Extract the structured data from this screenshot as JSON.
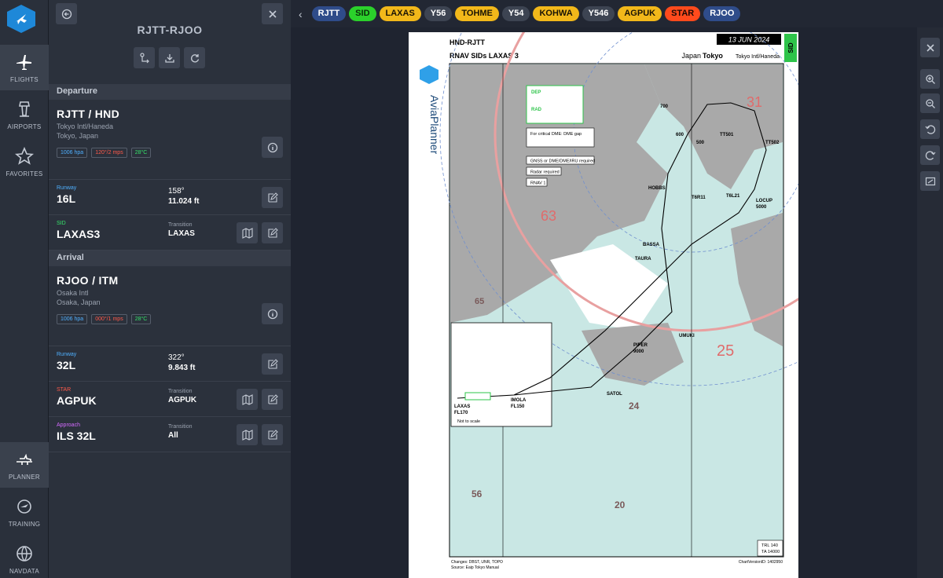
{
  "nav": {
    "items": [
      {
        "label": "FLIGHTS"
      },
      {
        "label": "AIRPORTS"
      },
      {
        "label": "FAVORITES"
      },
      {
        "label": "PLANNER"
      },
      {
        "label": "TRAINING"
      },
      {
        "label": "NAVDATA"
      }
    ]
  },
  "panel": {
    "route": "RJTT-RJOO",
    "departure_label": "Departure",
    "arrival_label": "Arrival",
    "departure": {
      "code": "RJTT / HND",
      "name": "Tokyo Intl/Haneda",
      "city": "Tokyo, Japan",
      "qnh": "1006 hpa",
      "wind": "120°/2 mps",
      "temp": "28°C",
      "runway_label": "Runway",
      "runway": "16L",
      "heading": "158°",
      "length": "11.024 ft",
      "sid_label": "SID",
      "sid": "LAXAS3",
      "transition_label": "Transition",
      "transition": "LAXAS"
    },
    "arrival": {
      "code": "RJOO / ITM",
      "name": "Osaka Intl",
      "city": "Osaka, Japan",
      "qnh": "1006 hpa",
      "wind": "000°/1 mps",
      "temp": "28°C",
      "runway_label": "Runway",
      "runway": "32L",
      "heading": "322°",
      "length": "9.843 ft",
      "star_label": "STAR",
      "star": "AGPUK",
      "star_transition_label": "Transition",
      "star_transition": "AGPUK",
      "approach_label": "Approach",
      "approach": "ILS 32L",
      "approach_transition_label": "Transition",
      "approach_transition": "All"
    }
  },
  "tabs": [
    {
      "label": "RJTT",
      "kind": "airport"
    },
    {
      "label": "SID",
      "kind": "sid"
    },
    {
      "label": "LAXAS",
      "kind": "wpt"
    },
    {
      "label": "Y56",
      "kind": "awy"
    },
    {
      "label": "TOHME",
      "kind": "wpt"
    },
    {
      "label": "Y54",
      "kind": "awy"
    },
    {
      "label": "KOHWA",
      "kind": "wpt"
    },
    {
      "label": "Y546",
      "kind": "awy"
    },
    {
      "label": "AGPUK",
      "kind": "wpt"
    },
    {
      "label": "STAR",
      "kind": "star"
    },
    {
      "label": "RJOO",
      "kind": "airport"
    }
  ],
  "chart": {
    "id": "HND-RJTT",
    "title": "RNAV SIDs LAXAS 3",
    "date": "13 JUN 2024",
    "country": "Japan",
    "city": "Tokyo",
    "airport": "Tokyo Intl/Haneda",
    "tag": "SID",
    "brand": "AviaPlanner",
    "freq_dep_label": "DEP",
    "freq_rad_label": "RAD",
    "notes": [
      "For critical DME: DME gap",
      "GNSS or DME/DME/IRU required",
      "Radar required",
      "RNAV 1"
    ],
    "not_to_scale": "Not to scale",
    "fixes": [
      "LAXAS",
      "IMOLA",
      "SATOL",
      "PIPER",
      "UMUKI",
      "TAURA",
      "BASSA",
      "HOBBS",
      "LOCUP",
      "TT501",
      "TT502",
      "T6R11",
      "T6L21"
    ],
    "altitudes": [
      "FL170",
      "FL150",
      "9000",
      "5000",
      "600",
      "500",
      "700"
    ],
    "msa": [
      "63",
      "65",
      "31",
      "25",
      "24",
      "56",
      "20"
    ],
    "trl": "TRL 140",
    "ta": "TA 14000",
    "footer_changes": "Changes: DBST, UNR, TOPO",
    "footer_source": "Source: Eaip Tokyo Manual",
    "chart_id_footer": "ChartVersionID: 1402950"
  },
  "colors": {
    "sid_green": "#2bd12b",
    "wpt_yellow": "#f2b81a",
    "star_red": "#ff4a1c",
    "airport_blue": "#2f4c8a"
  }
}
